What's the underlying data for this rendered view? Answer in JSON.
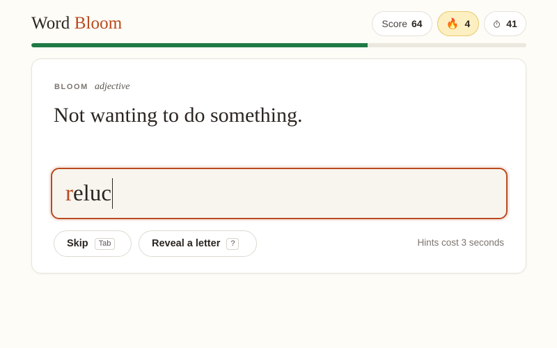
{
  "brand": {
    "word1": "Word",
    "word2": "Bloom",
    "accent_color": "#b9491d"
  },
  "stats": {
    "score_label": "Score",
    "score_value": "64",
    "streak_icon": "fire-icon",
    "streak_value": "4",
    "timer_icon": "stopwatch-icon",
    "timer_value": "41"
  },
  "progress": {
    "fraction": 0.68,
    "color": "#1f7a46"
  },
  "card": {
    "word_label": "BLOOM",
    "part_of_speech": "adjective",
    "definition": "Not wanting to do something."
  },
  "answer": {
    "first_letter": "r",
    "rest": "eluc",
    "value": "reluc"
  },
  "actions": {
    "skip_label": "Skip",
    "skip_key": "Tab",
    "reveal_label": "Reveal a letter",
    "reveal_key": "?",
    "hint_note": "Hints cost 3 seconds"
  }
}
